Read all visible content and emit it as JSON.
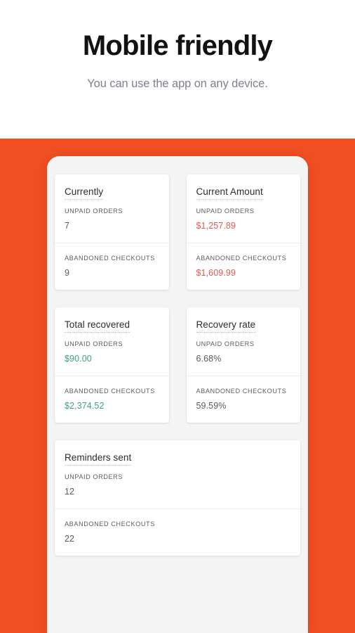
{
  "hero": {
    "title": "Mobile friendly",
    "subtitle": "You can use the app on any device."
  },
  "colors": {
    "background_band": "#f04e23",
    "phone_screen": "#f4f4f4",
    "card_background": "#ffffff",
    "value_negative": "#e2574c",
    "value_positive": "#3ea37c",
    "value_neutral": "#5b5b5b",
    "subtitle": "#7f808f",
    "title": "#121212"
  },
  "labels": {
    "unpaid_orders": "UNPAID ORDERS",
    "abandoned_checkouts": "ABANDONED CHECKOUTS"
  },
  "cards": [
    {
      "title": "Currently",
      "rows": [
        {
          "label": "UNPAID ORDERS",
          "value": "7",
          "tone": "plain"
        },
        {
          "label": "ABANDONED CHECKOUTS",
          "value": "9",
          "tone": "plain"
        }
      ]
    },
    {
      "title": "Current Amount",
      "rows": [
        {
          "label": "UNPAID ORDERS",
          "value": "$1,257.89",
          "tone": "red"
        },
        {
          "label": "ABANDONED CHECKOUTS",
          "value": "$1,609.99",
          "tone": "red"
        }
      ]
    },
    {
      "title": "Total recovered",
      "rows": [
        {
          "label": "UNPAID ORDERS",
          "value": "$90.00",
          "tone": "green"
        },
        {
          "label": "ABANDONED CHECKOUTS",
          "value": "$2,374.52",
          "tone": "green"
        }
      ]
    },
    {
      "title": "Recovery rate",
      "rows": [
        {
          "label": "UNPAID ORDERS",
          "value": "6.68%",
          "tone": "plain"
        },
        {
          "label": "ABANDONED CHECKOUTS",
          "value": "59.59%",
          "tone": "plain"
        }
      ]
    },
    {
      "title": "Reminders sent",
      "rows": [
        {
          "label": "UNPAID ORDERS",
          "value": "12",
          "tone": "plain"
        },
        {
          "label": "ABANDONED CHECKOUTS",
          "value": "22",
          "tone": "plain"
        }
      ]
    }
  ]
}
